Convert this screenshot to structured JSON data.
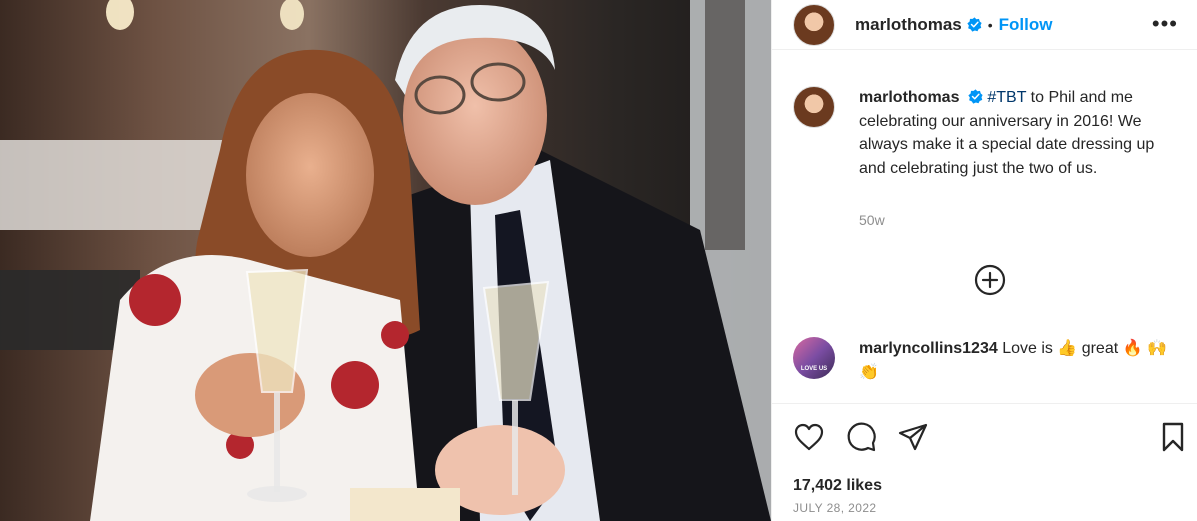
{
  "post": {
    "username": "marlothomas",
    "follow_label": "Follow",
    "separator": "•",
    "more_label": "•••",
    "caption": {
      "username": "marlothomas",
      "hashtag": "#TBT",
      "text": " to Phil and me celebrating our anniversary in 2016! We always make it a special date dressing up and celebrating just the two of us."
    },
    "time_ago": "50w",
    "comments": [
      {
        "username": "marlyncollins1234",
        "text": " Love is 👍 great 🔥 🙌👏",
        "avatar_caption": "LOVE US"
      }
    ],
    "likes": "17,402 likes",
    "date": "JULY 28, 2022"
  },
  "icons": {
    "verified": "verified-badge-icon",
    "more": "more-options-icon",
    "load_more": "plus-circle-icon",
    "like": "heart-icon",
    "comment": "comment-icon",
    "share": "paper-plane-icon",
    "save": "bookmark-icon"
  },
  "colors": {
    "accent": "#0095f6",
    "verified": "#0095f6",
    "hashtag": "#00376b",
    "muted": "#8e8e8e"
  }
}
